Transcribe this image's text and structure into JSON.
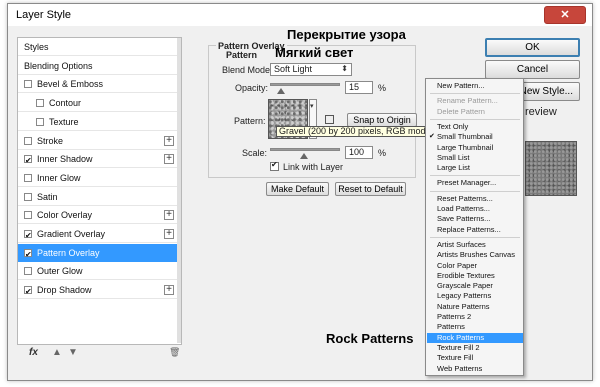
{
  "window": {
    "title": "Layer Style",
    "close_label": "✕"
  },
  "styles_list": {
    "rows": [
      {
        "label": "Styles",
        "checkbox": false,
        "checked": false,
        "plus": false,
        "indent": 0,
        "selected": false
      },
      {
        "label": "Blending Options",
        "checkbox": false,
        "checked": false,
        "plus": false,
        "indent": 0,
        "selected": false
      },
      {
        "label": "Bevel & Emboss",
        "checkbox": true,
        "checked": false,
        "plus": false,
        "indent": 0,
        "selected": false
      },
      {
        "label": "Contour",
        "checkbox": true,
        "checked": false,
        "plus": false,
        "indent": 1,
        "selected": false
      },
      {
        "label": "Texture",
        "checkbox": true,
        "checked": false,
        "plus": false,
        "indent": 1,
        "selected": false
      },
      {
        "label": "Stroke",
        "checkbox": true,
        "checked": false,
        "plus": true,
        "indent": 0,
        "selected": false
      },
      {
        "label": "Inner Shadow",
        "checkbox": true,
        "checked": true,
        "plus": true,
        "indent": 0,
        "selected": false
      },
      {
        "label": "Inner Glow",
        "checkbox": true,
        "checked": false,
        "plus": false,
        "indent": 0,
        "selected": false
      },
      {
        "label": "Satin",
        "checkbox": true,
        "checked": false,
        "plus": false,
        "indent": 0,
        "selected": false
      },
      {
        "label": "Color Overlay",
        "checkbox": true,
        "checked": false,
        "plus": true,
        "indent": 0,
        "selected": false
      },
      {
        "label": "Gradient Overlay",
        "checkbox": true,
        "checked": true,
        "plus": true,
        "indent": 0,
        "selected": false
      },
      {
        "label": "Pattern Overlay",
        "checkbox": true,
        "checked": true,
        "plus": false,
        "indent": 0,
        "selected": true
      },
      {
        "label": "Outer Glow",
        "checkbox": true,
        "checked": false,
        "plus": false,
        "indent": 0,
        "selected": false
      },
      {
        "label": "Drop Shadow",
        "checkbox": true,
        "checked": true,
        "plus": true,
        "indent": 0,
        "selected": false
      }
    ],
    "footer": {
      "fx_label": "fx",
      "up_icon": "▲",
      "down_icon": "▼",
      "trash_icon": "🗑"
    }
  },
  "pattern_overlay": {
    "group_title": "Pattern Overlay",
    "sub_title": "Pattern",
    "blend_mode_label": "Blend Mode:",
    "blend_mode_value": "Soft Light",
    "opacity_label": "Opacity:",
    "opacity_value": "15",
    "opacity_unit": "%",
    "opacity_level": 0.15,
    "pattern_label": "Pattern:",
    "snap_label": "Snap to Origin",
    "tooltip": "Gravel (200 by 200 pixels, RGB mode)",
    "scale_label": "Scale:",
    "scale_value": "100",
    "scale_unit": "%",
    "link_label": "Link with Layer",
    "link_checked": true,
    "make_default_label": "Make Default",
    "reset_default_label": "Reset to Default"
  },
  "overlay_text": {
    "line1": "Перекрытие узора",
    "line2": "Мягкий свет",
    "line3": "Rock Patterns"
  },
  "buttons": {
    "ok": "OK",
    "cancel": "Cancel",
    "new_style": "New Style...",
    "preview": "review"
  },
  "menu": {
    "items": [
      {
        "label": "New Pattern...",
        "state": "normal"
      },
      {
        "sep": true
      },
      {
        "label": "Rename Pattern...",
        "state": "disabled"
      },
      {
        "label": "Delete Pattern",
        "state": "disabled"
      },
      {
        "sep": true
      },
      {
        "label": "Text Only",
        "state": "normal"
      },
      {
        "label": "Small Thumbnail",
        "state": "checked"
      },
      {
        "label": "Large Thumbnail",
        "state": "normal"
      },
      {
        "label": "Small List",
        "state": "normal"
      },
      {
        "label": "Large List",
        "state": "normal"
      },
      {
        "sep": true
      },
      {
        "label": "Preset Manager...",
        "state": "normal"
      },
      {
        "sep": true
      },
      {
        "label": "Reset Patterns...",
        "state": "normal"
      },
      {
        "label": "Load Patterns...",
        "state": "normal"
      },
      {
        "label": "Save Patterns...",
        "state": "normal"
      },
      {
        "label": "Replace Patterns...",
        "state": "normal"
      },
      {
        "sep": true
      },
      {
        "label": "Artist Surfaces",
        "state": "normal"
      },
      {
        "label": "Artists Brushes Canvas",
        "state": "normal"
      },
      {
        "label": "Color Paper",
        "state": "normal"
      },
      {
        "label": "Erodible Textures",
        "state": "normal"
      },
      {
        "label": "Grayscale Paper",
        "state": "normal"
      },
      {
        "label": "Legacy Patterns",
        "state": "normal"
      },
      {
        "label": "Nature Patterns",
        "state": "normal"
      },
      {
        "label": "Patterns 2",
        "state": "normal"
      },
      {
        "label": "Patterns",
        "state": "normal"
      },
      {
        "label": "Rock Patterns",
        "state": "highlight"
      },
      {
        "label": "Texture Fill 2",
        "state": "normal"
      },
      {
        "label": "Texture Fill",
        "state": "normal"
      },
      {
        "label": "Web Patterns",
        "state": "normal"
      }
    ]
  },
  "colors": {
    "accent": "#3399ff",
    "close": "#c7463b"
  }
}
